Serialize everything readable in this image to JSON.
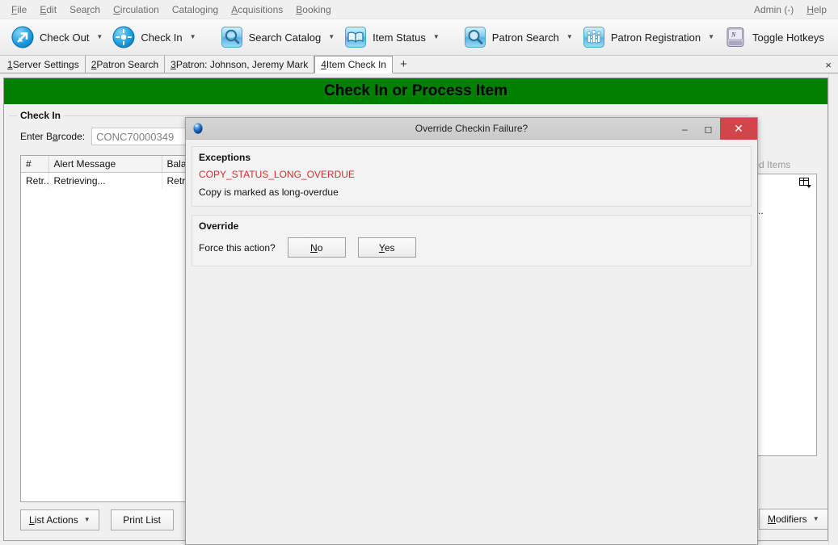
{
  "menubar": {
    "items": [
      {
        "label": "File",
        "accel": "F"
      },
      {
        "label": "Edit",
        "accel": "E"
      },
      {
        "label": "Search",
        "accel": "r"
      },
      {
        "label": "Circulation",
        "accel": "C"
      },
      {
        "label": "Cataloging",
        "accel": "g"
      },
      {
        "label": "Acquisitions",
        "accel": "A"
      },
      {
        "label": "Booking",
        "accel": "B"
      }
    ],
    "right": [
      {
        "label": "Admin (-)"
      },
      {
        "label": "Help"
      }
    ]
  },
  "toolbar": {
    "buttons": [
      {
        "label": "Check Out",
        "icon": "check-out-icon",
        "has_caret": true
      },
      {
        "label": "Check In",
        "icon": "check-in-icon",
        "has_caret": true
      },
      {
        "label": "Search Catalog",
        "icon": "search-catalog-icon",
        "has_caret": true
      },
      {
        "label": "Item Status",
        "icon": "item-status-icon",
        "has_caret": true
      },
      {
        "label": "Patron Search",
        "icon": "patron-search-icon",
        "has_caret": true
      },
      {
        "label": "Patron Registration",
        "icon": "patron-registration-icon",
        "has_caret": true
      }
    ],
    "toggle_hotkeys": {
      "label": "Toggle Hotkeys",
      "icon": "keyboard-key-icon"
    }
  },
  "tabs": {
    "items": [
      {
        "num": "1",
        "label": " Server Settings",
        "active": false
      },
      {
        "num": "2",
        "label": " Patron Search",
        "active": false
      },
      {
        "num": "3",
        "label": " Patron: Johnson, Jeremy Mark",
        "active": false
      },
      {
        "num": "4",
        "label": " Item Check In",
        "active": true
      }
    ],
    "add_label": "+",
    "close_label": "×"
  },
  "page": {
    "banner_title": "Check In or Process Item",
    "group_title": "Check In",
    "barcode_label_pre": "Enter B",
    "barcode_label_accel": "a",
    "barcode_label_post": "rcode:",
    "barcode_value": "CONC70000349",
    "barcode_placeholder": "",
    "table": {
      "columns": [
        "#",
        "Alert Message",
        "Balance"
      ],
      "rows": [
        {
          "num": "Retr...",
          "alert": "Retrieving...",
          "balance": "Retrievin"
        }
      ]
    },
    "buttons": {
      "list_actions_pre": "L",
      "list_actions_accel": "",
      "list_actions": "List Actions",
      "print_list": "Print List",
      "checkbox_checked": true
    },
    "right_panel": {
      "label": "elected Items",
      "cell_text": "g...",
      "modifiers_label": "Modifiers",
      "grid_icon": "table-settings-icon"
    }
  },
  "dialog": {
    "title": "Override Checkin Failure?",
    "icon": "globe-icon",
    "controls": {
      "minimize": "–",
      "maximize": "❐",
      "close": "✕"
    },
    "exceptions": {
      "group_title": "Exceptions",
      "code": "COPY_STATUS_LONG_OVERDUE",
      "description": "Copy is marked as long-overdue"
    },
    "override": {
      "group_title": "Override",
      "prompt": "Force this action?",
      "no_label": "No",
      "yes_label": "Yes"
    }
  },
  "colors": {
    "banner_green": "#008000",
    "error_red": "#d52b2b",
    "close_red": "#d0464a",
    "window_gray": "#f0f0f0"
  }
}
